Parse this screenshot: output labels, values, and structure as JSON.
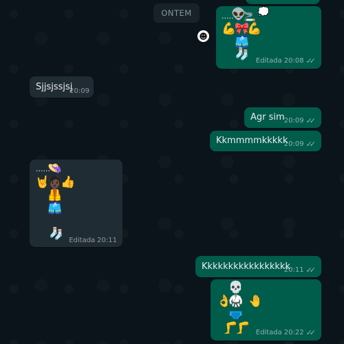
{
  "date_separator": "ONTEM",
  "messages": [
    {
      "direction": "out",
      "type": "emoji-art",
      "dots": ".....",
      "emojis": [
        "👽",
        "🚬",
        "💭",
        "💪",
        "🎀",
        "💪",
        "🩳",
        "🧦"
      ],
      "edited_label": "Editada",
      "time": "20:08"
    },
    {
      "direction": "in",
      "type": "text",
      "text": "Sjjsjssjsj",
      "time": "20:09"
    },
    {
      "direction": "out",
      "type": "text",
      "text": "Agr sim",
      "time": "20:09"
    },
    {
      "direction": "out",
      "type": "text",
      "text": "Kkmmmmkkkkk",
      "time": "20:09"
    },
    {
      "direction": "in",
      "type": "emoji-art",
      "dots": "......",
      "emojis": [
        "👒",
        "🤘",
        "🧑🏿",
        "👍",
        "🦺",
        "🩳",
        "🧦"
      ],
      "edited_label": "Editada",
      "time": "20:11"
    },
    {
      "direction": "out",
      "type": "text",
      "text": "Kkkkkkkkkkkkkkkkk",
      "time": "20:11"
    },
    {
      "direction": "out",
      "type": "emoji-art",
      "emojis": [
        "💀",
        "👌",
        "🥋",
        "🤚",
        "🩲",
        "🦵",
        "🦵"
      ],
      "edited_label": "Editada",
      "time": "20:22"
    }
  ],
  "icons": {
    "reaction": "smiley-icon",
    "read_receipt": "double-check-icon"
  },
  "colors": {
    "background": "#0b141a",
    "outgoing_bubble": "#005c4b",
    "incoming_bubble": "#202c33",
    "date_chip": "#182229"
  }
}
